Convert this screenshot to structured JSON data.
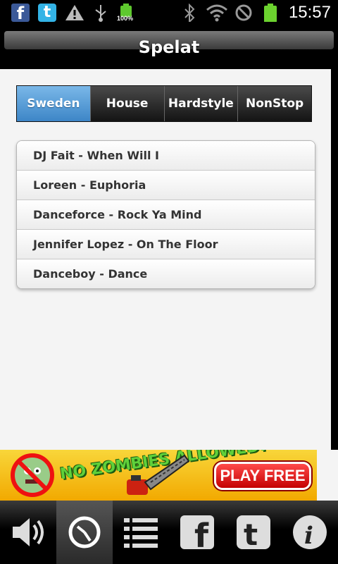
{
  "status_bar": {
    "time": "15:57",
    "battery_percent_label": "100%",
    "icons": [
      "facebook-icon",
      "twitter-icon",
      "warning-icon",
      "usb-icon",
      "battery-icon",
      "bluetooth-icon",
      "wifi-icon",
      "no-signal-icon",
      "battery-full-icon"
    ]
  },
  "header": {
    "title": "Spelat"
  },
  "tabs": [
    {
      "label": "Sweden",
      "active": true
    },
    {
      "label": "House",
      "active": false
    },
    {
      "label": "Hardstyle",
      "active": false
    },
    {
      "label": "NonStop",
      "active": false
    }
  ],
  "played_list": [
    "DJ Fait - When Will I",
    "Loreen - Euphoria",
    "Danceforce - Rock Ya Mind",
    "Jennifer Lopez - On The Floor",
    "Danceboy - Dance"
  ],
  "ad_banner": {
    "logo_text": "NO ZOMBIES ALLOWED!",
    "cta_label": "PLAY FREE"
  },
  "bottom_nav": [
    {
      "icon": "speaker-icon",
      "active": false
    },
    {
      "icon": "clock-icon",
      "active": true
    },
    {
      "icon": "list-icon",
      "active": false
    },
    {
      "icon": "facebook-icon",
      "active": false
    },
    {
      "icon": "twitter-icon",
      "active": false
    },
    {
      "icon": "info-icon",
      "active": false
    }
  ],
  "colors": {
    "active_tab": "#5a9fd6",
    "ad_background": "#f5c518",
    "cta_red": "#e01010"
  }
}
